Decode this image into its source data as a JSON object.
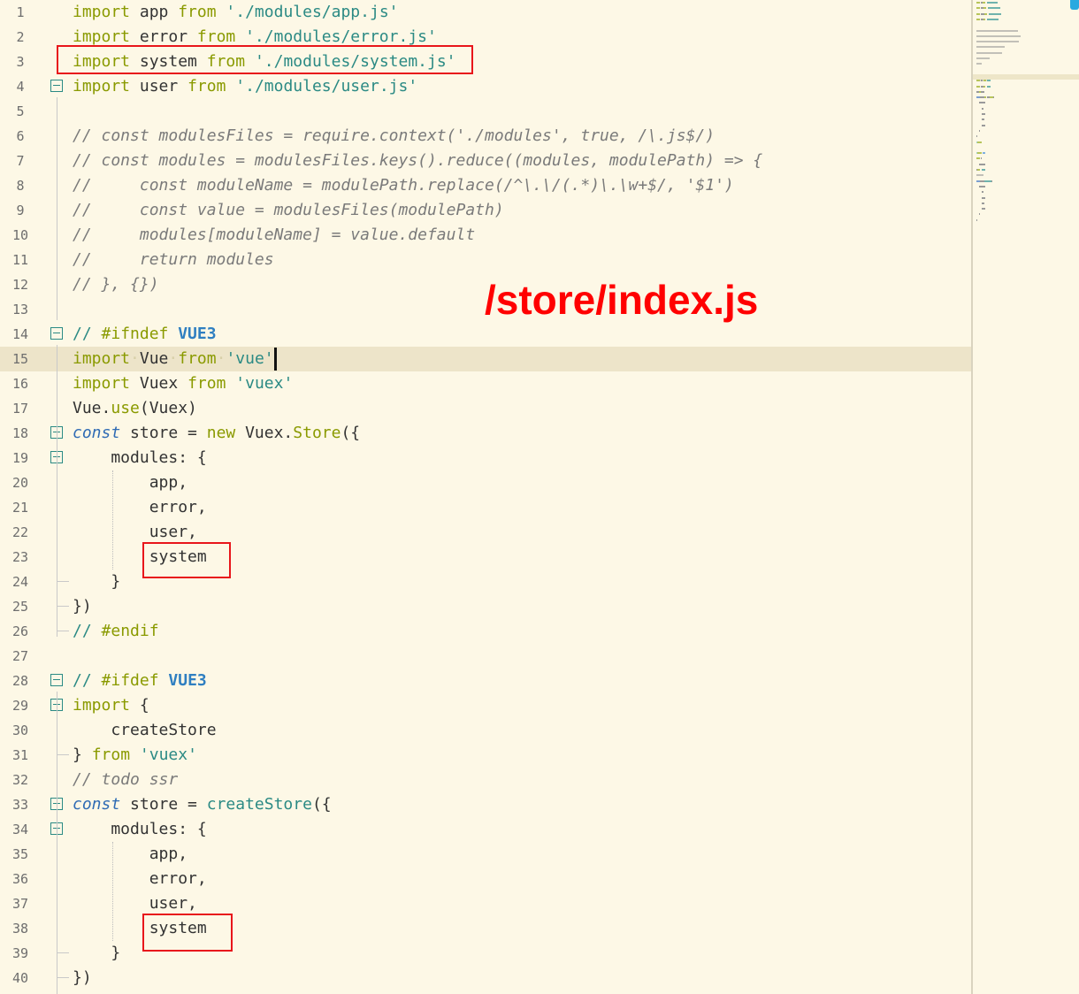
{
  "title_annotation": "/store/index.js",
  "lines": [
    {
      "n": "1",
      "t": [
        [
          "import",
          "kw"
        ],
        [
          " app ",
          ""
        ],
        [
          "from",
          "kw"
        ],
        [
          " ",
          ""
        ],
        [
          "'./modules/app.js'",
          "st"
        ]
      ]
    },
    {
      "n": "2",
      "t": [
        [
          "import",
          "kw"
        ],
        [
          " error ",
          ""
        ],
        [
          "from",
          "kw"
        ],
        [
          " ",
          ""
        ],
        [
          "'./modules/error.js'",
          "st"
        ]
      ]
    },
    {
      "n": "3",
      "t": [
        [
          "import",
          "kw"
        ],
        [
          " system ",
          ""
        ],
        [
          "from",
          "kw"
        ],
        [
          " ",
          ""
        ],
        [
          "'./modules/system.js'",
          "st"
        ]
      ]
    },
    {
      "n": "4",
      "fold": true,
      "t": [
        [
          "import",
          "kw"
        ],
        [
          " user ",
          ""
        ],
        [
          "from",
          "kw"
        ],
        [
          " ",
          ""
        ],
        [
          "'./modules/user.js'",
          "st"
        ]
      ]
    },
    {
      "n": "5",
      "t": []
    },
    {
      "n": "6",
      "t": [
        [
          "// const modulesFiles = require.context('./modules', true, /\\.js$/)",
          "cm"
        ]
      ]
    },
    {
      "n": "7",
      "t": [
        [
          "// const modules = modulesFiles.keys().reduce((modules, modulePath) => {",
          "cm"
        ]
      ]
    },
    {
      "n": "8",
      "t": [
        [
          "//     const moduleName = modulePath.replace(/^\\.\\/(.*)\\.\\w+$/, '$1')",
          "cm"
        ]
      ]
    },
    {
      "n": "9",
      "t": [
        [
          "//     const value = modulesFiles(modulePath)",
          "cm"
        ]
      ]
    },
    {
      "n": "10",
      "t": [
        [
          "//     modules[moduleName] = value.default",
          "cm"
        ]
      ]
    },
    {
      "n": "11",
      "t": [
        [
          "//     return modules",
          "cm"
        ]
      ]
    },
    {
      "n": "12",
      "t": [
        [
          "// }, {})",
          "cm"
        ]
      ]
    },
    {
      "n": "13",
      "t": []
    },
    {
      "n": "14",
      "fold": true,
      "t": [
        [
          "// ",
          "pp"
        ],
        [
          "#ifndef",
          "pk"
        ],
        [
          " ",
          ""
        ],
        [
          "VUE3",
          "mac"
        ]
      ]
    },
    {
      "n": "15",
      "hl": true,
      "t": [
        [
          "import",
          "kw"
        ],
        [
          "·",
          "ws"
        ],
        [
          "Vue",
          ""
        ],
        [
          "·",
          "ws"
        ],
        [
          "from",
          "kw"
        ],
        [
          "·",
          "ws"
        ],
        [
          "'vue'",
          "st"
        ]
      ],
      "cursor": true
    },
    {
      "n": "16",
      "t": [
        [
          "import",
          "kw"
        ],
        [
          " Vuex ",
          ""
        ],
        [
          "from",
          "kw"
        ],
        [
          " ",
          ""
        ],
        [
          "'vuex'",
          "st"
        ]
      ]
    },
    {
      "n": "17",
      "t": [
        [
          "Vue.",
          ""
        ],
        [
          "use",
          "fn"
        ],
        [
          "(Vuex)",
          ""
        ]
      ]
    },
    {
      "n": "18",
      "fold": true,
      "t": [
        [
          "const",
          "cst"
        ],
        [
          " store = ",
          ""
        ],
        [
          "new",
          "kw"
        ],
        [
          " Vuex.",
          ""
        ],
        [
          "Store",
          "cl"
        ],
        [
          "({",
          ""
        ]
      ]
    },
    {
      "n": "19",
      "fold": true,
      "t": [
        [
          "    modules: {",
          ""
        ]
      ]
    },
    {
      "n": "20",
      "t": [
        [
          "        app,",
          ""
        ]
      ]
    },
    {
      "n": "21",
      "t": [
        [
          "        error,",
          ""
        ]
      ]
    },
    {
      "n": "22",
      "t": [
        [
          "        user,",
          ""
        ]
      ]
    },
    {
      "n": "23",
      "t": [
        [
          "        system",
          ""
        ]
      ]
    },
    {
      "n": "24",
      "t": [
        [
          "    }",
          ""
        ]
      ]
    },
    {
      "n": "25",
      "t": [
        [
          "})",
          ""
        ]
      ]
    },
    {
      "n": "26",
      "t": [
        [
          "// ",
          "pp"
        ],
        [
          "#endif",
          "pk"
        ]
      ]
    },
    {
      "n": "27",
      "t": []
    },
    {
      "n": "28",
      "fold": true,
      "t": [
        [
          "// ",
          "pp"
        ],
        [
          "#ifdef",
          "pk"
        ],
        [
          " ",
          ""
        ],
        [
          "VUE3",
          "mac"
        ]
      ]
    },
    {
      "n": "29",
      "fold": true,
      "t": [
        [
          "import",
          "kw"
        ],
        [
          " {",
          ""
        ]
      ]
    },
    {
      "n": "30",
      "t": [
        [
          "    createStore",
          ""
        ]
      ]
    },
    {
      "n": "31",
      "t": [
        [
          "} ",
          ""
        ],
        [
          "from",
          "kw"
        ],
        [
          " ",
          ""
        ],
        [
          "'vuex'",
          "st"
        ]
      ]
    },
    {
      "n": "32",
      "t": [
        [
          "// todo ssr",
          "cm"
        ]
      ]
    },
    {
      "n": "33",
      "fold": true,
      "t": [
        [
          "const",
          "cst"
        ],
        [
          " store = ",
          ""
        ],
        [
          "createStore",
          "fd"
        ],
        [
          "({",
          ""
        ]
      ]
    },
    {
      "n": "34",
      "fold": true,
      "t": [
        [
          "    modules: {",
          ""
        ]
      ]
    },
    {
      "n": "35",
      "t": [
        [
          "        app,",
          ""
        ]
      ]
    },
    {
      "n": "36",
      "t": [
        [
          "        error,",
          ""
        ]
      ]
    },
    {
      "n": "37",
      "t": [
        [
          "        user,",
          ""
        ]
      ]
    },
    {
      "n": "38",
      "t": [
        [
          "        system",
          ""
        ]
      ]
    },
    {
      "n": "39",
      "t": [
        [
          "    }",
          ""
        ]
      ]
    },
    {
      "n": "40",
      "t": [
        [
          "})",
          ""
        ]
      ]
    }
  ],
  "colors": {
    "background": "#fdf8e6",
    "keyword": "#8a9a00",
    "string": "#2b8a84",
    "comment": "#7a7a7a",
    "macro": "#2f7fc1",
    "highlight_box": "#e8161b",
    "annotation": "#ff0000"
  }
}
